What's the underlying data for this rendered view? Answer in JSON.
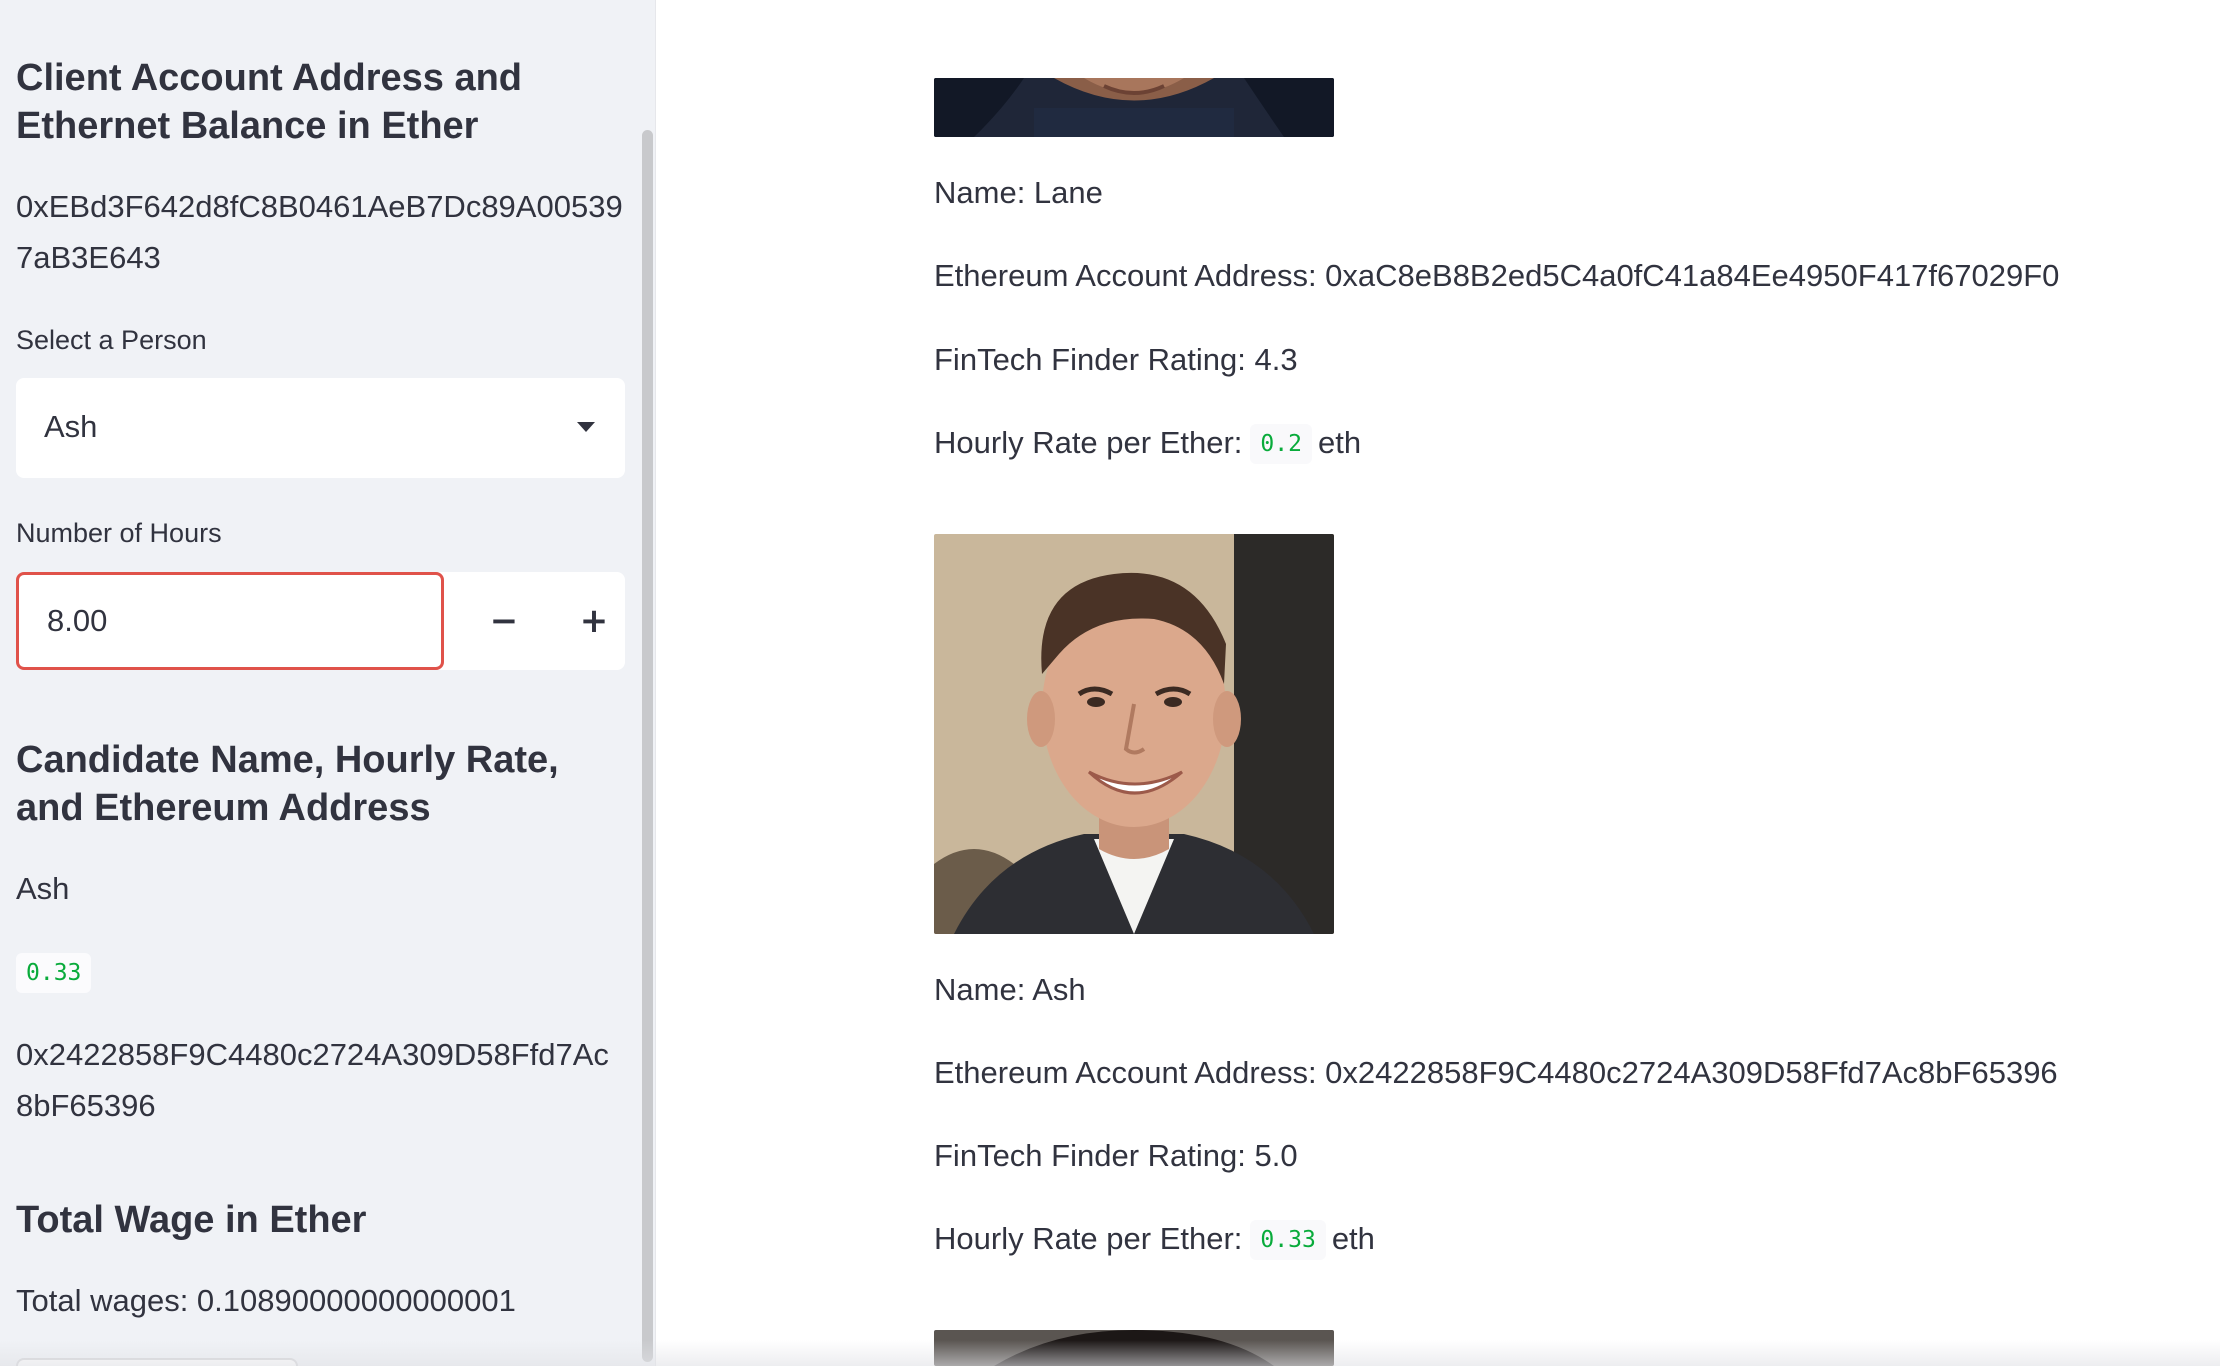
{
  "sidebar": {
    "client_heading": "Client Account Address and Ethernet Balance in Ether",
    "client_address": "0xEBd3F642d8fC8B0461AeB7Dc89A005397aB3E643",
    "select_label": "Select a Person",
    "select_value": "Ash",
    "hours_label": "Number of Hours",
    "hours_value": "8.00",
    "minus_label": "−",
    "plus_label": "+",
    "candidate_heading": "Candidate Name, Hourly Rate, and Ethereum Address",
    "candidate_name": "Ash",
    "candidate_rate": "0.33",
    "candidate_address": "0x2422858F9C4480c2724A309D58Ffd7Ac8bF65396",
    "wage_heading": "Total Wage in Ether",
    "total_wages": "Total wages: 0.10890000000000001"
  },
  "main": {
    "candidates": [
      {
        "name_line": "Name: Lane",
        "address_line": "Ethereum Account Address: 0xaC8eB8B2ed5C4a0fC41a84Ee4950F417f67029F0",
        "rating_line": "FinTech Finder Rating: 4.3",
        "rate_prefix": "Hourly Rate per Ether:",
        "rate_value": "0.2",
        "rate_unit": "eth"
      },
      {
        "name_line": "Name: Ash",
        "address_line": "Ethereum Account Address: 0x2422858F9C4480c2724A309D58Ffd7Ac8bF65396",
        "rating_line": "FinTech Finder Rating: 5.0",
        "rate_prefix": "Hourly Rate per Ether:",
        "rate_value": "0.33",
        "rate_unit": "eth"
      }
    ]
  },
  "colors": {
    "sidebar_bg": "#f0f2f6",
    "input_focus_border": "#e0524a",
    "code_text": "#09ab3b",
    "text": "#31333f"
  },
  "icons": {
    "select_caret": "chevron-down-icon"
  }
}
